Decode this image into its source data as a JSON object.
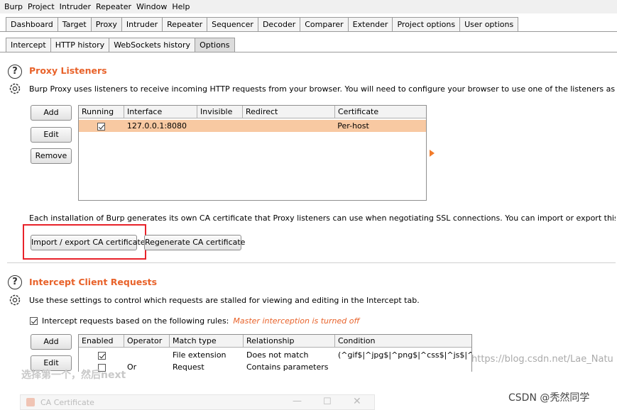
{
  "menu": [
    "Burp",
    "Project",
    "Intruder",
    "Repeater",
    "Window",
    "Help"
  ],
  "main_tabs": [
    "Dashboard",
    "Target",
    "Proxy",
    "Intruder",
    "Repeater",
    "Sequencer",
    "Decoder",
    "Comparer",
    "Extender",
    "Project options",
    "User options"
  ],
  "main_active": "Proxy",
  "sub_tabs": [
    "Intercept",
    "HTTP history",
    "WebSockets history",
    "Options"
  ],
  "sub_active": "Options",
  "proxy_listeners": {
    "title": "Proxy Listeners",
    "description": "Burp Proxy uses listeners to receive incoming HTTP requests from your browser. You will need to configure your browser to use one of the listeners as its proxy server.",
    "add_label": "Add",
    "edit_label": "Edit",
    "remove_label": "Remove",
    "columns": [
      "Running",
      "Interface",
      "Invisible",
      "Redirect",
      "Certificate"
    ],
    "rows": [
      {
        "running": true,
        "interface": "127.0.0.1:8080",
        "invisible": "",
        "redirect": "",
        "certificate": "Per-host"
      }
    ],
    "ca_text": "Each installation of Burp generates its own CA certificate that Proxy listeners can use when negotiating SSL connections. You can import or export this certificate for use in other tools or",
    "import_export_label": "Import / export CA certificate",
    "regenerate_label": "Regenerate CA certificate"
  },
  "intercept_client": {
    "title": "Intercept Client Requests",
    "description": "Use these settings to control which requests are stalled for viewing and editing in the Intercept tab.",
    "rule_checkbox_label": "Intercept requests based on the following rules:",
    "rule_checked": true,
    "master_note": "Master interception is turned off",
    "add_label": "Add",
    "edit_label": "Edit",
    "columns": [
      "Enabled",
      "Operator",
      "Match type",
      "Relationship",
      "Condition"
    ],
    "rows": [
      {
        "enabled": true,
        "operator": "",
        "match_type": "File extension",
        "relationship": "Does not match",
        "condition": "(^gif$|^jpg$|^png$|^css$|^js$|^ico$)"
      },
      {
        "enabled": false,
        "operator": "Or",
        "match_type": "Request",
        "relationship": "Contains parameters",
        "condition": ""
      }
    ]
  },
  "overlay": {
    "chinese_caption": "选择第一个，然后next",
    "dialog_title": "CA Certificate",
    "watermark_url": "https://blog.csdn.net/Lae_Natu",
    "csdn_label": "CSDN @秃然同学"
  },
  "colors": {
    "accent": "#e8622a",
    "selected_row": "#f8c9a2",
    "highlight_box": "#e8222a"
  }
}
